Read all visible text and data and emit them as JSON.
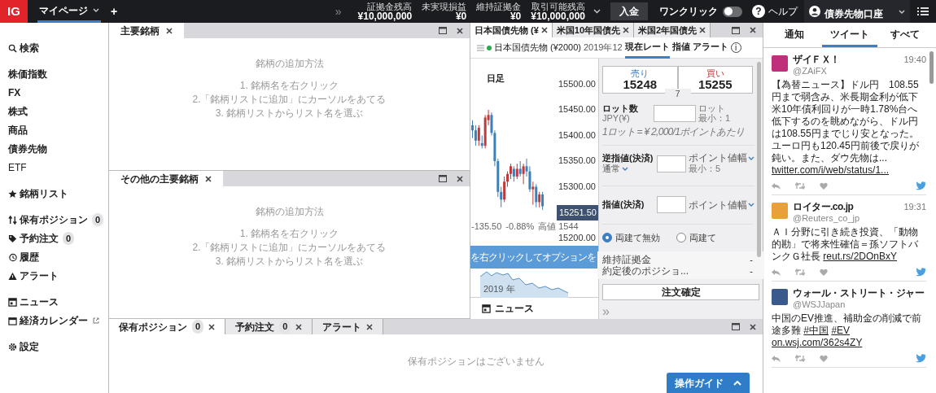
{
  "topbar": {
    "logo": "IG",
    "tabs": [
      {
        "label": "マイページ",
        "selected": true
      }
    ],
    "add": "+",
    "more": "»",
    "stats": [
      {
        "label": "証拠金残高",
        "value": "¥10,000,000"
      },
      {
        "label": "未実現損益",
        "value": "¥0"
      },
      {
        "label": "維持証拠金",
        "value": "¥0"
      },
      {
        "label": "取引可能残高",
        "value": "¥10,000,000"
      }
    ],
    "deposit": "入金",
    "one_click": {
      "label": "ワンクリック",
      "on": false
    },
    "help": "ヘルプ",
    "help_mark": "?",
    "account": "債券先物口座"
  },
  "sidebar": [
    [
      {
        "label": "検索",
        "bold": true
      }
    ],
    [
      {
        "label": "株価指数",
        "bold": true
      },
      {
        "label": "FX",
        "bold": true
      },
      {
        "label": "株式",
        "bold": true
      },
      {
        "label": "商品",
        "bold": true
      },
      {
        "label": "債券先物",
        "bold": true
      },
      {
        "label": "ETF",
        "bold": false
      }
    ],
    [
      {
        "label": "銘柄リスト",
        "bold": true
      }
    ],
    [
      {
        "label": "保有ポジション",
        "badge": "0",
        "bold": true
      },
      {
        "label": "予約注文",
        "badge": "0",
        "bold": true
      },
      {
        "label": "履歴",
        "bold": true
      },
      {
        "label": "アラート",
        "bold": true
      }
    ],
    [
      {
        "label": "ニュース",
        "bold": true
      },
      {
        "label": "経済カレンダー",
        "bold": true
      }
    ],
    [
      {
        "label": "設定",
        "bold": true
      }
    ]
  ],
  "watchlists": [
    {
      "tab": "主要銘柄",
      "heading": "銘柄の追加方法",
      "steps": [
        "1. 銘柄名を右クリック",
        "2.「銘柄リストに追加」にカーソルをあてる",
        "3. 銘柄リストからリスト名を選ぶ"
      ]
    },
    {
      "tab": "その他の主要銘柄",
      "heading": "銘柄の追加方法",
      "steps": [
        "1. 銘柄名を右クリック",
        "2.「銘柄リストに追加」にカーソルをあてる",
        "3. 銘柄リストからリスト名を選ぶ"
      ]
    }
  ],
  "deal": {
    "tabs": [
      {
        "label": "日本国債先物 (¥",
        "selected": true
      },
      {
        "label": "米国10年国債先",
        "selected": false
      },
      {
        "label": "米国2年国債先",
        "selected": false
      }
    ],
    "instrument": "日本国債先物 (¥2000)",
    "expiry": "2019年12",
    "modes": [
      {
        "label": "現在レート",
        "selected": true
      },
      {
        "label": "指値",
        "selected": false
      },
      {
        "label": "アラート",
        "selected": false
      }
    ],
    "info": "i",
    "chart": {
      "period": "日足",
      "current": "15251.50",
      "stats": [
        "-135.50",
        "-0.88%",
        "高値 1544"
      ],
      "banner": "を右クリックしてオプションを",
      "nav_label": "2019 年",
      "chart_data": {
        "type": "candlestick",
        "ylim": [
          15185,
          15550
        ],
        "ohlc": [
          [
            15420,
            15430,
            15395,
            15410
          ],
          [
            15410,
            15420,
            15380,
            15390
          ],
          [
            15390,
            15420,
            15380,
            15415
          ],
          [
            15385,
            15400,
            15375,
            15380
          ],
          [
            15380,
            15440,
            15375,
            15435
          ],
          [
            15430,
            15450,
            15420,
            15440
          ],
          [
            15440,
            15445,
            15400,
            15405
          ],
          [
            15405,
            15410,
            15340,
            15350
          ],
          [
            15350,
            15355,
            15280,
            15290
          ],
          [
            15290,
            15300,
            15260,
            15275
          ],
          [
            15275,
            15320,
            15270,
            15310
          ],
          [
            15310,
            15330,
            15300,
            15325
          ],
          [
            15325,
            15345,
            15315,
            15340
          ],
          [
            15335,
            15340,
            15310,
            15320
          ],
          [
            15320,
            15345,
            15315,
            15335
          ],
          [
            15335,
            15350,
            15320,
            15325
          ],
          [
            15325,
            15345,
            15305,
            15340
          ],
          [
            15340,
            15355,
            15320,
            15330
          ],
          [
            15330,
            15340,
            15290,
            15295
          ],
          [
            15295,
            15310,
            15265,
            15300
          ],
          [
            15300,
            15305,
            15260,
            15270
          ],
          [
            15270,
            15290,
            15260,
            15285
          ],
          [
            15285,
            15290,
            15255,
            15262
          ]
        ],
        "yticks": [
          {
            "value": 15500,
            "label": "15500.00"
          },
          {
            "value": 15450,
            "label": "15450.00"
          },
          {
            "value": 15400,
            "label": "15400.00"
          },
          {
            "value": 15350,
            "label": "15350.00"
          },
          {
            "value": 15300,
            "label": "15300.00"
          },
          {
            "value": 15200,
            "label": "15200.00"
          }
        ]
      }
    },
    "sell": {
      "label": "売り",
      "price": "15248"
    },
    "buy": {
      "label": "買い",
      "price": "15255"
    },
    "spread": "7",
    "size": {
      "label": "ロット数",
      "unit": "JPY(¥)",
      "right1": "ロット",
      "right2": "最小：1",
      "note": "1ロット = ¥ 2,000/1ポイントあたり"
    },
    "stop": {
      "label": "逆指値(決済)",
      "sub": "通常",
      "right1": "ポイント値幅",
      "right2": "最小：5"
    },
    "limit": {
      "label": "指値(決済)",
      "right1": "ポイント値幅"
    },
    "hedge": [
      {
        "label": "両建て無効",
        "selected": true
      },
      {
        "label": "両建て",
        "selected": false
      }
    ],
    "summary": [
      {
        "label": "維持証拠金",
        "value": "-"
      },
      {
        "label": "約定後のポジショ...",
        "value": "-"
      }
    ],
    "submit": "注文確定",
    "expand": "»",
    "news": "ニュース"
  },
  "positions": {
    "tabs": [
      {
        "label": "保有ポジション",
        "badge": "0",
        "selected": true
      },
      {
        "label": "予約注文",
        "badge": "0",
        "selected": false
      },
      {
        "label": "アラート",
        "selected": false
      }
    ],
    "empty": "保有ポジションはございません",
    "guide": "操作ガイド"
  },
  "feed": {
    "tabs": [
      {
        "label": "通知",
        "selected": false
      },
      {
        "label": "ツイート",
        "selected": true
      },
      {
        "label": "すべて",
        "selected": false
      }
    ],
    "tweets": [
      {
        "name": "ザイＦＸ！",
        "handle": "@ZAiFX",
        "time": "19:40",
        "color": "#c0307a",
        "text": "【為替ニュース】ドル円　108.55円まで弱含み、米長期金利が低下米10年債利回りが一時1.78%台へ低下するのを眺めながら、ドル円は108.55円までじり安となった。ユーロ円も120.45円前後で戻りが鈍い。また、ダウ先物は...",
        "links": [
          "twitter.com/i/web/status/1..."
        ]
      },
      {
        "name": "ロイター.co.jp",
        "handle": "@Reuters_co_jp",
        "time": "19:31",
        "color": "#e8a13a",
        "text": "ＡＩ分野に引き続き投資、「動物的勘」で将来性確信＝孫ソフトバンクＧ社長",
        "links": [
          "reut.rs/2DOnBxY"
        ]
      },
      {
        "name": "ウォール・ストリート・ジャー",
        "handle": "@WSJJapan",
        "color": "#3a5a8c",
        "text": "中国のEV推進、補助金の削減で前途多難",
        "links": [
          "#中国",
          "#EV",
          "on.wsj.com/362s4ZY"
        ]
      }
    ]
  }
}
